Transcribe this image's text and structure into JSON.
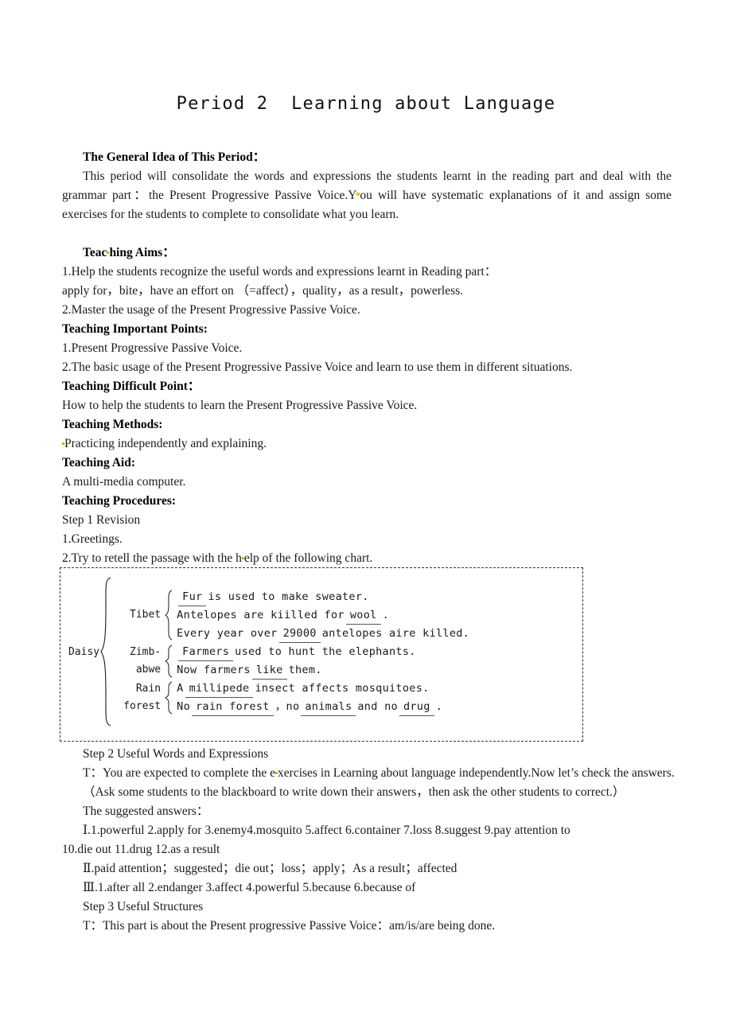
{
  "document": {
    "title": "Period 2  Learning about Language"
  },
  "sections": {
    "general_idea": {
      "heading": "The General Idea of This Period：",
      "body_1": "This period will consolidate the words and expressions the students learnt in the reading part and deal with the grammar part：the Present Progressive Passive Voice.Y",
      "body_2": "ou will have systematic explanations of it and assign some exercises for the students to complete to consolidate what you learn."
    },
    "teaching_aims": {
      "heading": "Teac",
      "heading_rest": "hing Aims：",
      "item_1": "1.Help the students recognize the useful words and expressions learnt in Reading part：",
      "item_1_words": "apply for，bite，have an effort on （=affect），quality，as a result，powerless.",
      "item_2": "2.Master the usage of the Present Progressive Passive Voice."
    },
    "important_points": {
      "heading": "Teaching Important Points:",
      "item_1": "1.Present Progressive Passive Voice.",
      "item_2": "2.The basic usage of the Present Progressive Passive Voice and learn to use them in different situations."
    },
    "difficult_point": {
      "heading": "Teaching Difficult Point：",
      "item_1": "How to help the students to learn the Present Progressive Passive Voice."
    },
    "methods": {
      "heading": "Teaching Methods:",
      "item_1": "Practicing independently and explaining."
    },
    "aid": {
      "heading": "Teaching Aid:",
      "item_1": "A multi-media computer."
    },
    "procedures": {
      "heading": "Teaching Procedures:",
      "step_1": "Step 1 Revision",
      "step_1_a": "1.Greetings.",
      "step_1_b_pre": "2.Try to retell the passage with the h",
      "step_1_b_post": "elp of the following chart."
    },
    "step2": {
      "title": "Step 2 Useful Words and Expressions",
      "teacher_line_pre": "T：You are expected to complete the e",
      "teacher_line_post": "xercises in Learning about language independently.Now let’s check the answers.",
      "note": "（Ask some students to the blackboard to write down their answers，then ask the other students to correct.）",
      "suggested_label": "The suggested answers：",
      "answers_1_a": "Ⅰ.1.powerful  2.apply for  3.enemy4.mosquito  5.affect  6.container  7.loss  8.suggest  9.pay attention to",
      "answers_1_b": "10.die out  11.drug  12.as a result",
      "answers_2": "Ⅱ.paid attention；suggested；die out；loss；apply；As a result；affected",
      "answers_3": "Ⅲ.1.after all  2.endanger  3.affect  4.powerful  5.because  6.because of"
    },
    "step3": {
      "title": "Step 3 Useful Structures",
      "teacher_line": "T：This part is about the Present progressive Passive Voice：am/is/are being done."
    }
  },
  "chart": {
    "root_label": "Daisy",
    "groups": [
      {
        "name": "Tibet",
        "name_line_1": "Tibet",
        "name_line_2": "",
        "lines": [
          {
            "pre": "",
            "blank": "Fur",
            "mid": "is used to make sweater.",
            "blank2": "",
            "post": ""
          },
          {
            "pre": "Antelopes are kiilled for",
            "blank": "wool",
            "mid": ".",
            "blank2": "",
            "post": ""
          },
          {
            "pre": "Every year over",
            "blank": "29000",
            "mid": "antelopes aire killed.",
            "blank2": "",
            "post": ""
          }
        ]
      },
      {
        "name": "Zimbabwe",
        "name_line_1": "Zimb-",
        "name_line_2": "abwe",
        "lines": [
          {
            "pre": "",
            "blank": "Farmers",
            "mid": "used to hunt the elephants.",
            "blank2": "",
            "post": ""
          },
          {
            "pre": "Now farmers",
            "blank": "like",
            "mid": "them.",
            "blank2": "",
            "post": ""
          }
        ]
      },
      {
        "name": "Rain forest",
        "name_line_1": "Rain",
        "name_line_2": "forest",
        "lines": [
          {
            "pre": "A",
            "blank": "millipede",
            "mid": "insect affects mosquitoes.",
            "blank2": "",
            "post": ""
          },
          {
            "pre": "No",
            "blank": "rain forest",
            "mid": "，no",
            "blank2": "animals",
            "post": "and no",
            "blank3": "drug",
            "tail": "."
          }
        ]
      }
    ]
  },
  "colors": {
    "text": "#1a1a1a",
    "highlight": "#d8c400",
    "border": "#333333"
  }
}
